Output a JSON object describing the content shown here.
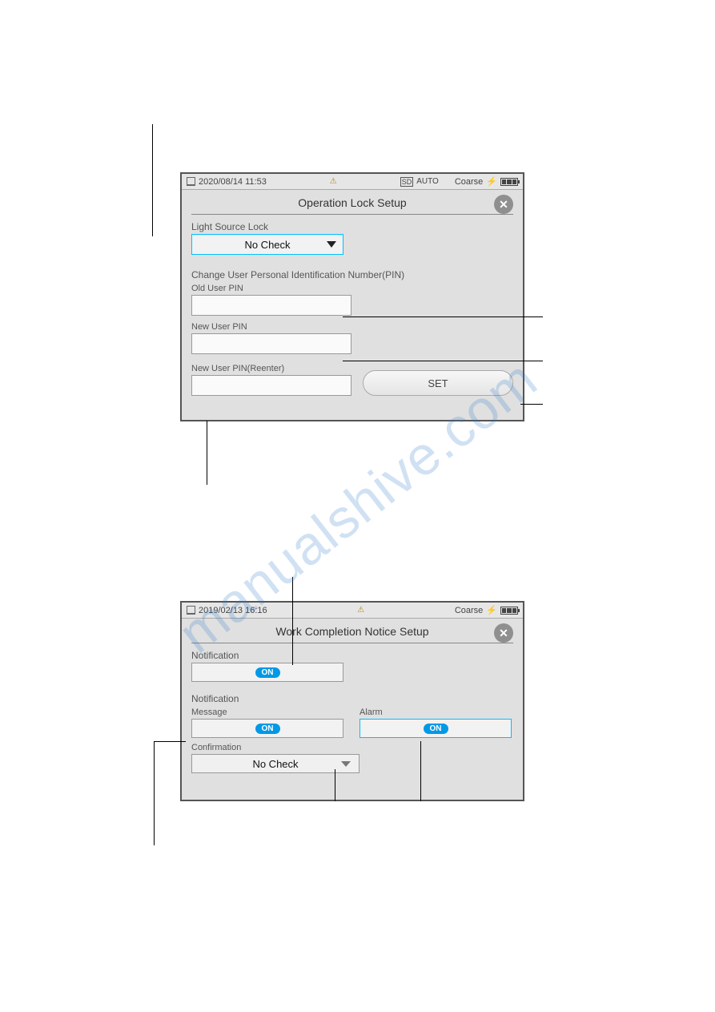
{
  "watermark": "manualshive.com",
  "screen1": {
    "status": {
      "datetime": "2020/08/14 11:53",
      "auto_label": "AUTO",
      "mode_label": "Coarse"
    },
    "title": "Operation Lock Setup",
    "light_source_lock_label": "Light Source Lock",
    "light_source_lock_value": "No Check",
    "change_pin_label": "Change User Personal Identification Number(PIN)",
    "old_pin_label": "Old User PIN",
    "new_pin_label": "New User PIN",
    "new_pin_reenter_label": "New User PIN(Reenter)",
    "set_button": "SET"
  },
  "screen2": {
    "status": {
      "datetime": "2019/02/13 16:16",
      "mode_label": "Coarse"
    },
    "title": "Work Completion Notice Setup",
    "notification_label": "Notification",
    "notification_value": "ON",
    "notification_section_label": "Notification",
    "message_label": "Message",
    "message_value": "ON",
    "alarm_label": "Alarm",
    "alarm_value": "ON",
    "confirmation_label": "Confirmation",
    "confirmation_value": "No Check"
  }
}
